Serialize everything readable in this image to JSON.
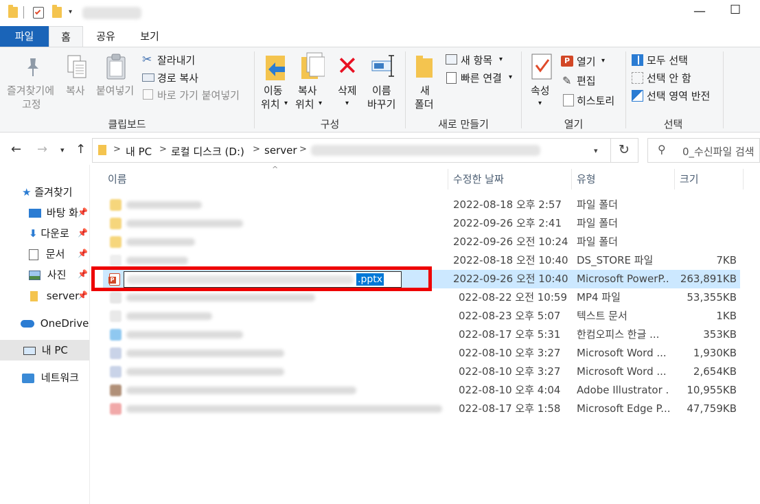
{
  "window": {
    "title_blurred": "",
    "minimize_glyph": "—",
    "maximize_glyph": "☐"
  },
  "ribbon_tabs": [
    {
      "label": "파일"
    },
    {
      "label": "홈"
    },
    {
      "label": "공유"
    },
    {
      "label": "보기"
    }
  ],
  "clipboard": {
    "pin_label_1": "즐겨찾기에",
    "pin_label_2": "고정",
    "copy_label": "복사",
    "paste_label": "붙여넣기",
    "cut_label": "잘라내기",
    "copy_path_label": "경로 복사",
    "paste_shortcut_label": "바로 가기 붙여넣기",
    "group_label": "클립보드"
  },
  "organize": {
    "move_label_1": "이동",
    "move_label_2": "위치",
    "copy_to_label_1": "복사",
    "copy_to_label_2": "위치",
    "delete_label": "삭제",
    "rename_label_1": "이름",
    "rename_label_2": "바꾸기",
    "group_label": "구성"
  },
  "new": {
    "new_folder_label_1": "새",
    "new_folder_label_2": "폴더",
    "new_item_label": "새 항목",
    "easy_access_label": "빠른 연결",
    "group_label": "새로 만들기"
  },
  "open": {
    "properties_label": "속성",
    "open_label": "열기",
    "edit_label": "편집",
    "history_label": "히스토리",
    "group_label": "열기"
  },
  "select": {
    "select_all_label": "모두 선택",
    "select_none_label": "선택 안 함",
    "invert_label": "선택 영역 반전",
    "group_label": "선택"
  },
  "address": {
    "crumbs": [
      "내 PC",
      "로컬 디스크 (D:)",
      "server"
    ],
    "separator": ">"
  },
  "search": {
    "placeholder": "0_수신파일 검색"
  },
  "nav_pane": {
    "items": [
      {
        "label": "즐겨찾기"
      },
      {
        "label": "바탕 화"
      },
      {
        "label": "다운로"
      },
      {
        "label": "문서"
      },
      {
        "label": "사진"
      },
      {
        "label": "server"
      },
      {
        "label": "OneDrive"
      },
      {
        "label": "내 PC"
      },
      {
        "label": "네트워크"
      }
    ]
  },
  "columns": {
    "name": "이름",
    "date": "수정한 날짜",
    "type": "유형",
    "size": "크기"
  },
  "files": [
    {
      "date": "2022-08-18 오후 2:57",
      "type": "파일 폴더",
      "size": "",
      "icon_color": "#f6d67c",
      "selected": false
    },
    {
      "date": "2022-09-26 오후 2:41",
      "type": "파일 폴더",
      "size": "",
      "icon_color": "#f6d67c",
      "selected": false
    },
    {
      "date": "2022-09-26 오전 10:24",
      "type": "파일 폴더",
      "size": "",
      "icon_color": "#f6d67c",
      "selected": false
    },
    {
      "date": "2022-08-18 오전 10:40",
      "type": "DS_STORE 파일",
      "size": "7KB",
      "icon_color": "#eeeeee",
      "selected": false
    },
    {
      "date": "2022-09-26 오전 10:40",
      "type": "Microsoft PowerP...",
      "size": "263,891KB",
      "icon_color": "#d24726",
      "selected": true
    },
    {
      "date": "022-08-22 오전 10:59",
      "type": "MP4 파일",
      "size": "53,355KB",
      "icon_color": "#e6e6e6",
      "selected": false
    },
    {
      "date": "022-08-23 오후 5:07",
      "type": "텍스트 문서",
      "size": "1KB",
      "icon_color": "#e9e9e9",
      "selected": false
    },
    {
      "date": "022-08-17 오후 5:31",
      "type": "한컴오피스 한글 ...",
      "size": "353KB",
      "icon_color": "#8fc8f0",
      "selected": false
    },
    {
      "date": "022-08-10 오후 3:27",
      "type": "Microsoft Word ...",
      "size": "1,930KB",
      "icon_color": "#c9d3e8",
      "selected": false
    },
    {
      "date": "022-08-10 오후 3:27",
      "type": "Microsoft Word ...",
      "size": "2,654KB",
      "icon_color": "#c9d3e8",
      "selected": false
    },
    {
      "date": "022-08-10 오후 4:04",
      "type": "Adobe Illustrator ...",
      "size": "10,955KB",
      "icon_color": "#b09078",
      "selected": false
    },
    {
      "date": "022-08-17 오후 1:58",
      "type": "Microsoft Edge P...",
      "size": "47,759KB",
      "icon_color": "#f1a9a9",
      "selected": false
    }
  ],
  "rename": {
    "extension": ".pptx"
  },
  "colors": {
    "file_tab": "#1a64b8",
    "selection": "#cce8ff",
    "highlight_box": "#ee0000",
    "text_highlight": "#0078d7"
  }
}
